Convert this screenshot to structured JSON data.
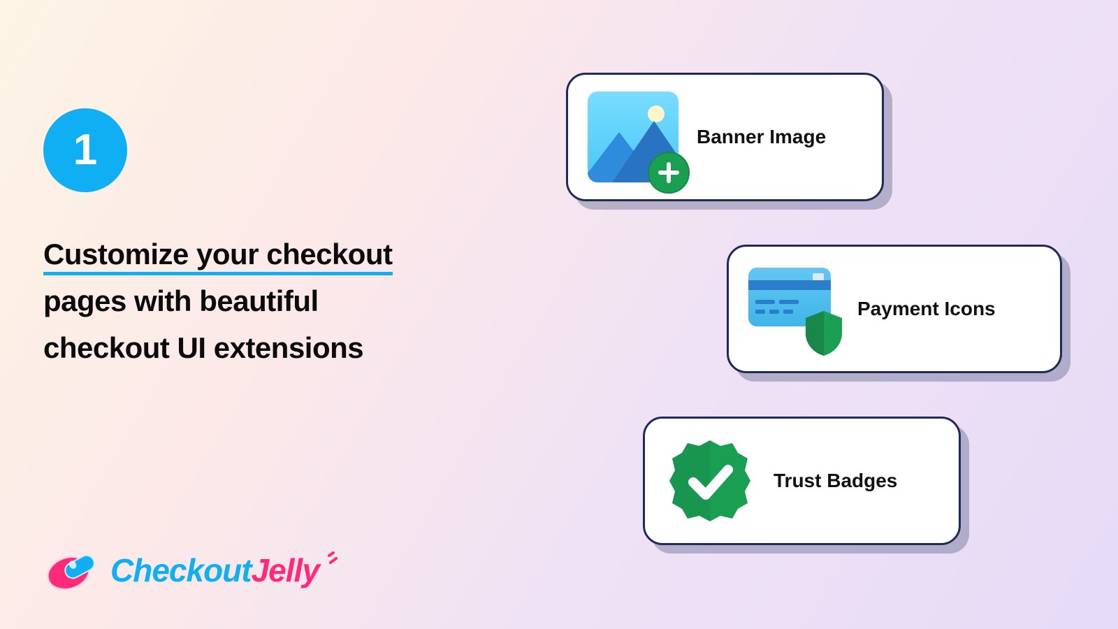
{
  "step": "1",
  "headline": {
    "line1": "Customize your checkout",
    "line2": "pages with beautiful",
    "line3": "checkout UI extensions"
  },
  "brand": {
    "part1": "Checkout",
    "part2": "Jelly"
  },
  "cards": {
    "banner": "Banner Image",
    "payment": "Payment Icons",
    "trust": "Trust Badges"
  }
}
